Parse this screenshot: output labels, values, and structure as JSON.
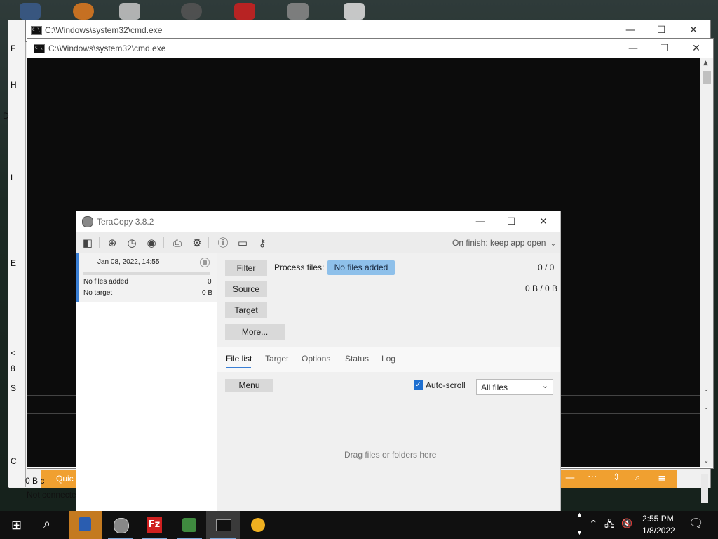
{
  "background_window": {
    "side_letters": [
      "F",
      "H",
      "D",
      "L",
      "E",
      "<",
      "8",
      "S",
      "C"
    ],
    "status_size": "0 B c",
    "status_text": "Not connecte",
    "quick_label": "Quic"
  },
  "cmd_back": {
    "title": "C:\\Windows\\system32\\cmd.exe"
  },
  "cmd_front": {
    "title": "C:\\Windows\\system32\\cmd.exe"
  },
  "window_buttons": {
    "minimize": "—",
    "maximize": "☐",
    "close": "✕"
  },
  "teracopy": {
    "title": "TeraCopy 3.8.2",
    "on_finish": "On finish: keep app open",
    "job": {
      "date": "Jan 08, 2022, 14:55",
      "source": "No files added",
      "source_count": "0",
      "target": "No target",
      "target_size": "0 B"
    },
    "buttons": {
      "filter": "Filter",
      "source": "Source",
      "target": "Target",
      "more": "More...",
      "menu": "Menu"
    },
    "process_files_label": "Process files:",
    "process_files_value": "No files added",
    "file_count": "0 / 0",
    "byte_count": "0 B / 0 B",
    "tabs": [
      "File list",
      "Target",
      "Options",
      "Status",
      "Log"
    ],
    "auto_scroll_label": "Auto-scroll",
    "auto_scroll_checked": true,
    "filter_select": "All files",
    "empty_text": "Drag files or folders here"
  },
  "taskbar": {
    "time": "2:55 PM",
    "date": "1/8/2022"
  },
  "colors": {
    "accent": "#3a7fd5",
    "pill": "#8ec0ea",
    "checkbox": "#1e6fd0",
    "filezilla_toolbar": "#f0a030"
  }
}
